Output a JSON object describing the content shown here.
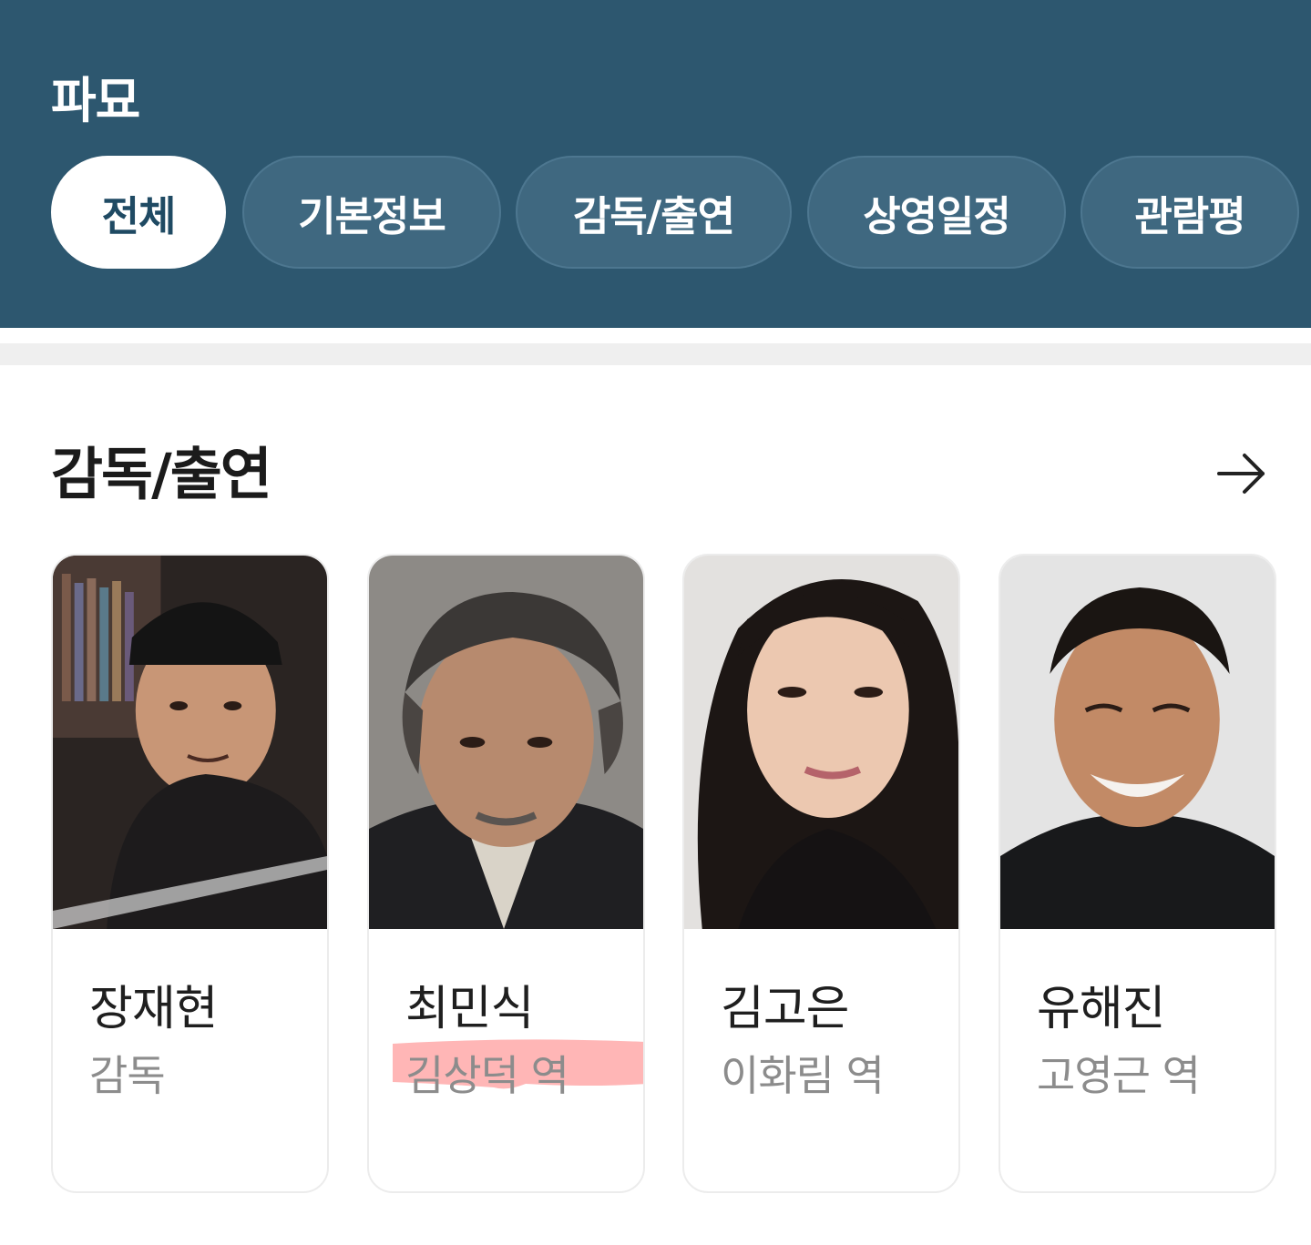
{
  "header": {
    "title": "파묘",
    "tabs": [
      {
        "label": "전체",
        "active": true
      },
      {
        "label": "기본정보",
        "active": false
      },
      {
        "label": "감독/출연",
        "active": false
      },
      {
        "label": "상영일정",
        "active": false
      },
      {
        "label": "관람평",
        "active": false
      }
    ]
  },
  "cast_section": {
    "title": "감독/출연",
    "more_icon": "arrow-right-icon",
    "people": [
      {
        "name": "장재현",
        "role": "감독"
      },
      {
        "name": "최민식",
        "role": "김상덕 역",
        "highlighted": true
      },
      {
        "name": "김고은",
        "role": "이화림 역"
      },
      {
        "name": "유해진",
        "role": "고영근 역"
      }
    ]
  },
  "colors": {
    "header_bg": "#2d576f",
    "tab_bg": "#3f6880",
    "active_tab_text": "#1f4a63",
    "highlight": "#ff9e9e"
  }
}
